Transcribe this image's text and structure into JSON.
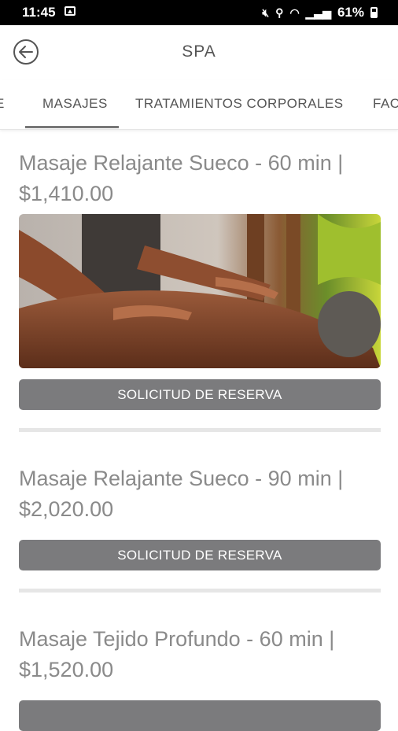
{
  "status_bar": {
    "time": "11:45",
    "battery": "61%"
  },
  "header": {
    "title": "SPA"
  },
  "tabs": [
    {
      "label": "E"
    },
    {
      "label": "MASAJES"
    },
    {
      "label": "TRATAMIENTOS CORPORALES"
    },
    {
      "label": "FAC"
    }
  ],
  "items": [
    {
      "title_line1": "Masaje Relajante Sueco - 60 min |",
      "title_line2": "$1,410.00",
      "button": "SOLICITUD DE RESERVA"
    },
    {
      "title_line1": "Masaje Relajante Sueco - 90 min |",
      "title_line2": "$2,020.00",
      "button": "SOLICITUD DE RESERVA"
    },
    {
      "title_line1": "Masaje Tejido Profundo - 60 min |",
      "title_line2": "$1,520.00"
    }
  ],
  "colors": {
    "button_bg": "#7b7b7d",
    "tab_indicator": "#777777"
  },
  "icons": {
    "back": "back-arrow-circle-icon",
    "gallery": "image-icon",
    "mute": "mute-icon",
    "location": "location-icon",
    "wifi": "wifi-icon",
    "signal": "signal-icon",
    "battery": "battery-icon"
  }
}
